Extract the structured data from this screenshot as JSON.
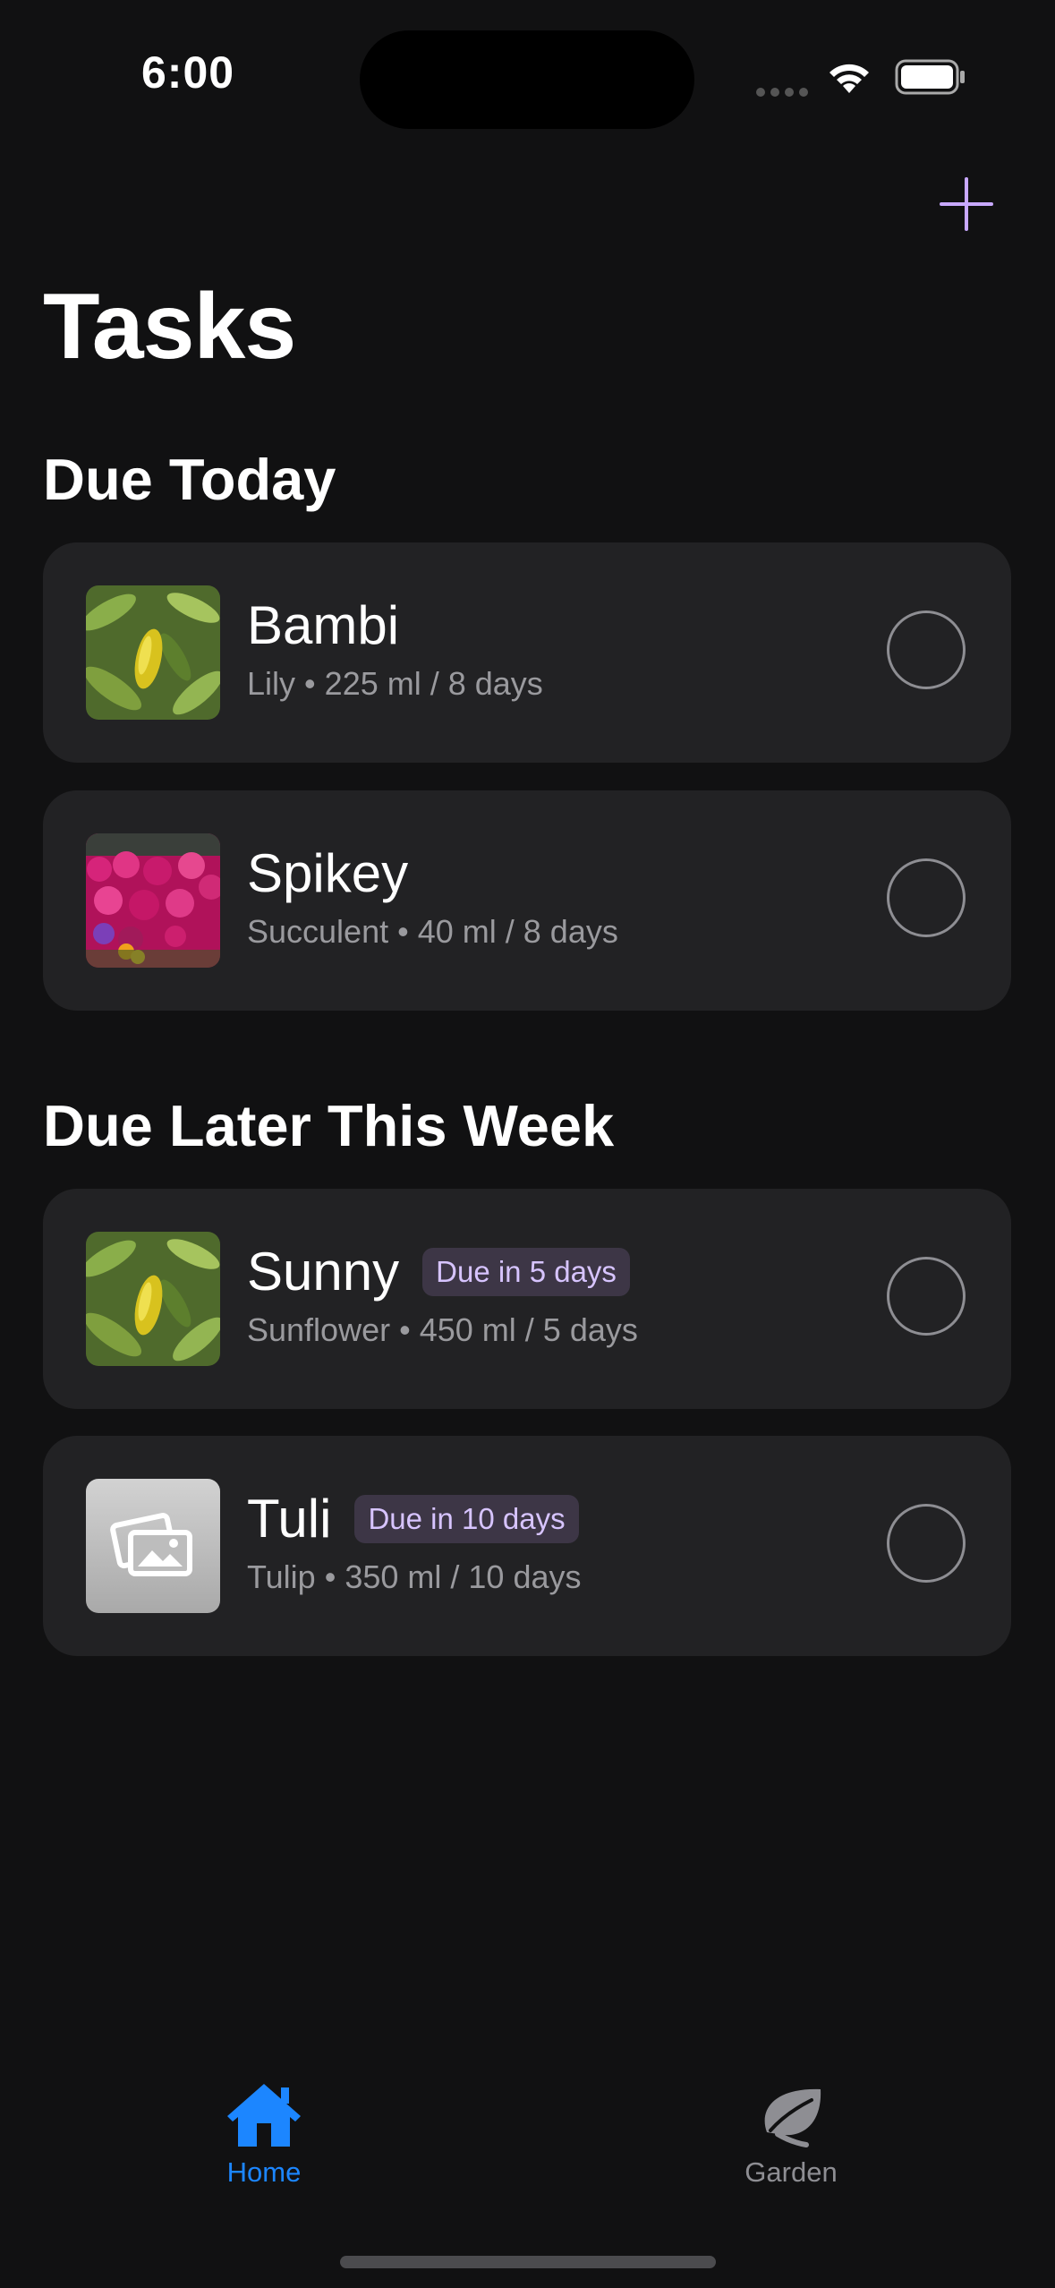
{
  "status_bar": {
    "time": "6:00"
  },
  "header": {
    "title": "Tasks",
    "add_icon": "plus-icon",
    "accent_color": "#c8a8ff"
  },
  "sections": [
    {
      "title": "Due Today",
      "items": [
        {
          "name": "Bambi",
          "badge": "",
          "species": "Lily",
          "separator": "•",
          "schedule": "225 ml / 8 days",
          "thumbnail": "yellow-leaf-photo"
        },
        {
          "name": "Spikey",
          "badge": "",
          "species": "Succulent",
          "separator": "•",
          "schedule": "40 ml / 8 days",
          "thumbnail": "pink-flowers-photo"
        }
      ]
    },
    {
      "title": "Due Later This Week",
      "items": [
        {
          "name": "Sunny",
          "badge": "Due in 5 days",
          "species": "Sunflower",
          "separator": "•",
          "schedule": "450 ml / 5 days",
          "thumbnail": "yellow-leaf-photo"
        },
        {
          "name": "Tuli",
          "badge": "Due in 10 days",
          "species": "Tulip",
          "separator": "•",
          "schedule": "350 ml / 10 days",
          "thumbnail": "placeholder-photo-icon"
        }
      ]
    }
  ],
  "tab_bar": {
    "tabs": [
      {
        "label": "Home",
        "icon": "house-icon",
        "active": true,
        "color": "#1c86ff"
      },
      {
        "label": "Garden",
        "icon": "leaf-icon",
        "active": false,
        "color": "#8e8e93"
      }
    ]
  }
}
